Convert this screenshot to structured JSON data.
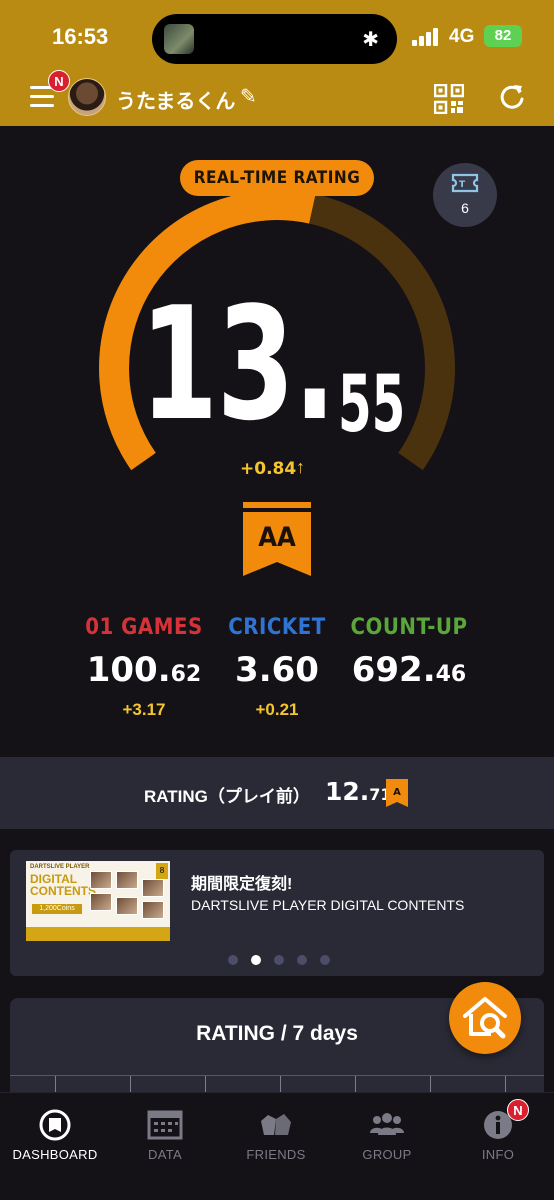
{
  "status_bar": {
    "time": "16:53",
    "network": "4G",
    "battery": "82"
  },
  "header": {
    "notification_badge": "N",
    "username": "うたまるくん",
    "edit_icon": "pencil-icon",
    "qr_icon": "qr-code-icon",
    "refresh_icon": "refresh-icon"
  },
  "rating": {
    "label": "REAL-TIME RATING",
    "value_int": "13.",
    "value_dec": "55",
    "delta": "+0.84",
    "delta_arrow": "↑",
    "class": "AA",
    "gauge_fill_fraction": 0.55,
    "accent_color": "#f28b0c",
    "track_color": "#4a320f",
    "ticket_count": "6"
  },
  "stats": [
    {
      "name": "01 GAMES",
      "value_int": "100.",
      "value_dec": "62",
      "diff": "+3.17",
      "color": "#d6323a"
    },
    {
      "name": "CRICKET",
      "value_int": "3.60",
      "value_dec": "",
      "diff": "+0.21",
      "color": "#2f73d3"
    },
    {
      "name": "COUNT-UP",
      "value_int": "692.",
      "value_dec": "46",
      "diff": "",
      "color": "#5aa63a"
    }
  ],
  "rating_before": {
    "label": "RATING（プレイ前）",
    "value_int": "12.",
    "value_dec": "71",
    "class": "A"
  },
  "banner": {
    "title": "期間限定復刻!",
    "subtitle": "DARTSLIVE PLAYER DIGITAL CONTENTS",
    "promo_heading": "DARTSLIVE PLAYER",
    "promo_title_line1": "DIGITAL",
    "promo_title_line2": "CONTENTS",
    "promo_coins": "1,200Coins",
    "promo_number": "8",
    "active_dot": 1,
    "dot_count": 5
  },
  "chart_card": {
    "title": "RATING / 7 days"
  },
  "tabs": [
    {
      "label": "DASHBOARD",
      "icon": "dashboard-icon",
      "active": true
    },
    {
      "label": "DATA",
      "icon": "calendar-icon",
      "active": false
    },
    {
      "label": "FRIENDS",
      "icon": "friends-icon",
      "active": false
    },
    {
      "label": "GROUP",
      "icon": "group-icon",
      "active": false
    },
    {
      "label": "INFO",
      "icon": "info-icon",
      "active": false,
      "badge": "N"
    }
  ]
}
